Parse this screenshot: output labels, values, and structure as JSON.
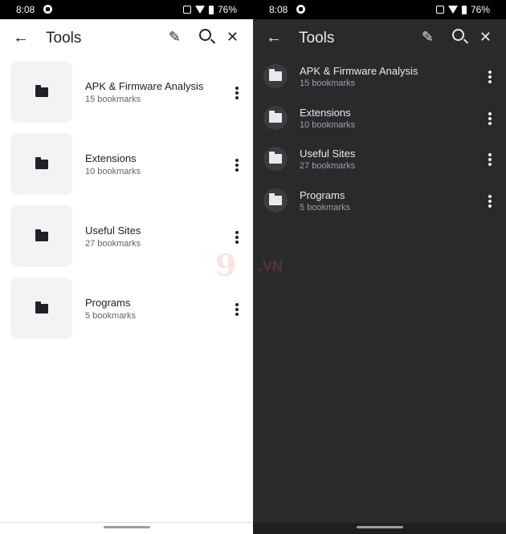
{
  "status": {
    "time": "8:08",
    "battery": "76%"
  },
  "appbar": {
    "title": "Tools",
    "back_icon": "arrow-back-icon",
    "edit_icon": "pencil-icon",
    "search_icon": "search-icon",
    "close_icon": "close-icon"
  },
  "folders": [
    {
      "name": "APK & Firmware Analysis",
      "count": "15 bookmarks"
    },
    {
      "name": "Extensions",
      "count": "10 bookmarks"
    },
    {
      "name": "Useful Sites",
      "count": "27 bookmarks"
    },
    {
      "name": "Programs",
      "count": "5 bookmarks"
    }
  ],
  "watermark": {
    "brand": "9",
    "domain": ".VN"
  },
  "colors": {
    "light_bg": "#ffffff",
    "dark_bg": "#2a2a2c",
    "light_text": "#202124",
    "dark_text": "#e8eaed"
  }
}
